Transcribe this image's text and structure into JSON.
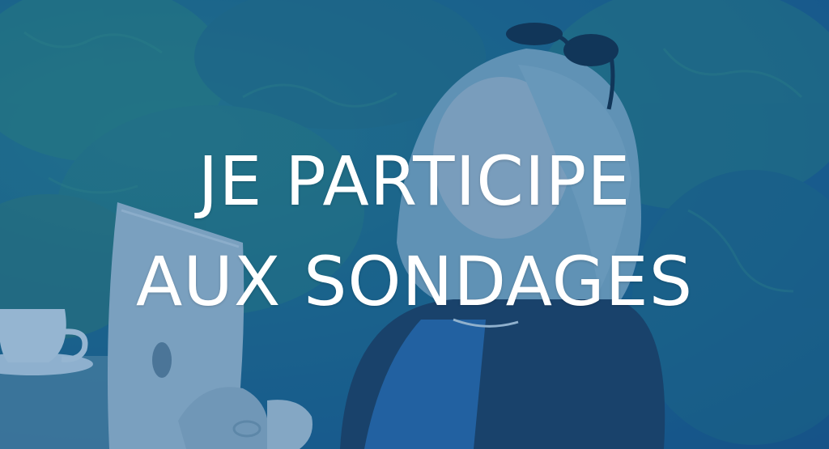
{
  "banner": {
    "headline_line1": "JE PARTICIPE",
    "headline_line2": "AUX SONDAGES",
    "overlay_color": "#1a5f96",
    "text_color": "#ffffff"
  },
  "photo": {
    "subject": "woman-with-tablet",
    "icons": [
      "sunglasses-icon",
      "tablet-icon",
      "cup-icon"
    ]
  }
}
